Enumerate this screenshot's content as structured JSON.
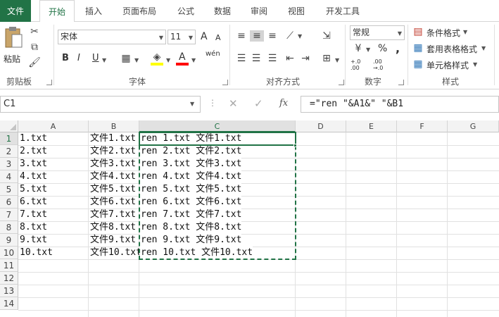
{
  "tabs": [
    "文件",
    "开始",
    "插入",
    "页面布局",
    "公式",
    "数据",
    "审阅",
    "视图",
    "开发工具"
  ],
  "ribbon": {
    "clipboard": {
      "paste": "粘贴",
      "label": "剪贴板"
    },
    "font": {
      "name": "宋体",
      "size": "11",
      "bold": "B",
      "italic": "I",
      "underline": "U",
      "grow": "A",
      "shrink": "A",
      "wen": "wén",
      "label": "字体"
    },
    "align": {
      "label": "对齐方式"
    },
    "number": {
      "format": "常规",
      "percent": "%",
      "comma": ",",
      "inc": "+.0 .00",
      "dec": ".00 →.0",
      "label": "数字"
    },
    "styles": {
      "cond": "条件格式",
      "table": "套用表格格式",
      "cell": "单元格样式",
      "label": "样式"
    }
  },
  "formula_bar": {
    "name_box": "C1",
    "fx": "fx",
    "formula": "=\"ren \"&A1&\" \"&B1"
  },
  "columns": [
    "A",
    "B",
    "C",
    "D",
    "E",
    "F",
    "G"
  ],
  "rows": [
    "1",
    "2",
    "3",
    "4",
    "5",
    "6",
    "7",
    "8",
    "9",
    "10",
    "11",
    "12",
    "13",
    "14"
  ],
  "cells": {
    "A": [
      "1.txt",
      "2.txt",
      "3.txt",
      "4.txt",
      "5.txt",
      "6.txt",
      "7.txt",
      "8.txt",
      "9.txt",
      "10.txt"
    ],
    "B": [
      "文件1.txt",
      "文件2.txt",
      "文件3.txt",
      "文件4.txt",
      "文件5.txt",
      "文件6.txt",
      "文件7.txt",
      "文件8.txt",
      "文件9.txt",
      "文件10.txt"
    ],
    "C": [
      "ren 1.txt 文件1.txt",
      "ren 2.txt 文件2.txt",
      "ren 3.txt 文件3.txt",
      "ren 4.txt 文件4.txt",
      "ren 5.txt 文件5.txt",
      "ren 6.txt 文件6.txt",
      "ren 7.txt 文件7.txt",
      "ren 8.txt 文件8.txt",
      "ren 9.txt 文件9.txt",
      "ren 10.txt 文件10.txt"
    ]
  },
  "colors": {
    "accent": "#217346",
    "font_highlight": "#ffff00",
    "font_color": "#ff0000"
  }
}
